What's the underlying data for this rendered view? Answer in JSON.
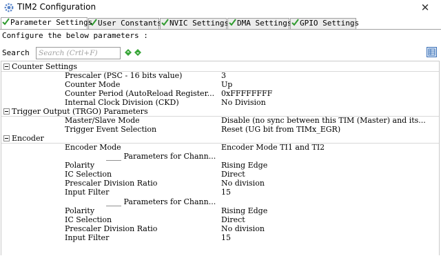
{
  "window": {
    "title": "TIM2 Configuration",
    "close_glyph": "✕"
  },
  "tabs": [
    {
      "label": "Parameter Settings",
      "active": true
    },
    {
      "label": "User Constants",
      "active": false
    },
    {
      "label": "NVIC Settings",
      "active": false
    },
    {
      "label": "DMA Settings",
      "active": false
    },
    {
      "label": "GPIO Settings",
      "active": false
    }
  ],
  "panel": {
    "configure_text": "Configure the below parameters :",
    "search_label": "Search :",
    "search_placeholder": "Search (Crtl+F)",
    "search_value": ""
  },
  "groups": [
    {
      "label": "Counter Settings",
      "params": [
        {
          "name": "Prescaler (PSC - 16 bits value)",
          "value": "3"
        },
        {
          "name": "Counter Mode",
          "value": "Up"
        },
        {
          "name": "Counter Period (AutoReload Register...",
          "value": "0xFFFFFFFF"
        },
        {
          "name": "Internal Clock Division (CKD)",
          "value": "No Division"
        }
      ]
    },
    {
      "label": "Trigger Output (TRGO) Parameters",
      "params": [
        {
          "name": "Master/Slave Mode",
          "value": "Disable (no sync between this TIM (Master) and its..."
        },
        {
          "name": "Trigger Event Selection",
          "value": "Reset (UG bit from TIMx_EGR)"
        }
      ]
    },
    {
      "label": "Encoder",
      "params": [
        {
          "name": "Encoder Mode",
          "value": "Encoder Mode TI1 and TI2"
        },
        {
          "name": "____ Parameters for Chann...",
          "value": "",
          "sub": true
        },
        {
          "name": "Polarity",
          "value": "Rising Edge"
        },
        {
          "name": "IC Selection",
          "value": "Direct"
        },
        {
          "name": "Prescaler Division Ratio",
          "value": "No division"
        },
        {
          "name": "Input Filter",
          "value": "15"
        },
        {
          "name": "____ Parameters for Chann...",
          "value": "",
          "sub": true
        },
        {
          "name": "Polarity",
          "value": "Rising Edge"
        },
        {
          "name": "IC Selection",
          "value": "Direct"
        },
        {
          "name": "Prescaler Division Ratio",
          "value": "No division"
        },
        {
          "name": "Input Filter",
          "value": "15"
        }
      ]
    }
  ],
  "colors": {
    "check_green": "#2e9b2e",
    "arrow_green": "#3aa63a",
    "accent_blue": "#3a6fb6"
  },
  "icons": {
    "app": "gear-icon",
    "tab_status": "check-icon",
    "search_prev": "previous-arrow-icon",
    "search_next": "next-arrow-icon",
    "view_toggle": "list-view-icon",
    "group_toggle": "collapse-icon"
  }
}
